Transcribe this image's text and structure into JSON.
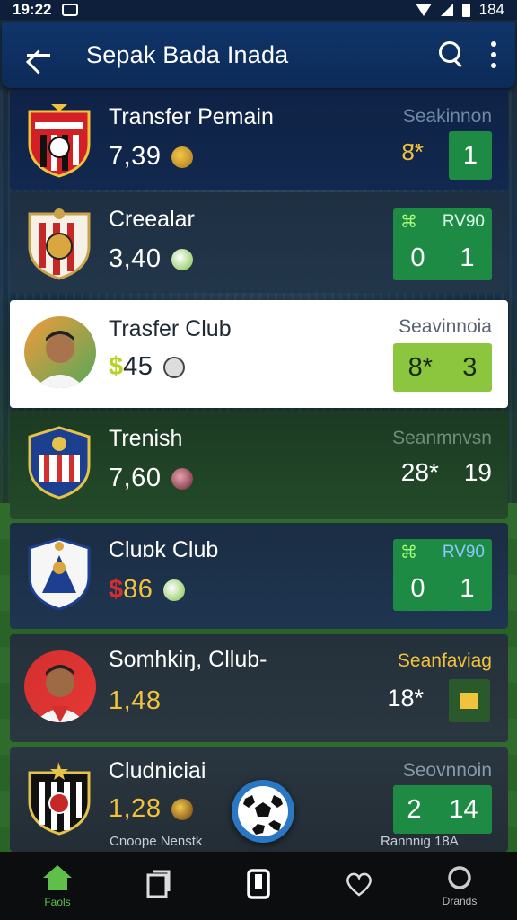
{
  "status_bar": {
    "time": "19:22",
    "battery": "184"
  },
  "app_bar": {
    "title": "Sepak Bada Inada"
  },
  "cards": [
    {
      "name": "Transfer Pemain",
      "value": "7,39",
      "currency": "",
      "right_label": "Seakinnon",
      "score": [
        "8̈*",
        "1"
      ]
    },
    {
      "name": "Creealar",
      "value": "3,40",
      "currency": "",
      "right_label": "",
      "score_header": [
        "RV90"
      ],
      "score": [
        "0",
        "1"
      ]
    },
    {
      "name": "Trasfer Club",
      "value": "45",
      "currency": "$",
      "right_label": "Seavinnoia",
      "score": [
        "8*",
        "3"
      ]
    },
    {
      "name": "Trenish",
      "value": "7,60",
      "currency": "",
      "right_label": "Seanmnvsn",
      "score": [
        "28*",
        "19"
      ]
    },
    {
      "name": "Cluɒk Club",
      "value": "86",
      "currency": "$",
      "right_label": "",
      "score_header": [
        "RV90"
      ],
      "score": [
        "0",
        "1"
      ]
    },
    {
      "name": "Somhkiŋ, Cllub-",
      "value": "1,48",
      "currency": "",
      "right_label": "Seanfaviag",
      "score": [
        "18*",
        ""
      ]
    },
    {
      "name": "Cludniciai",
      "value": "1,28",
      "currency": "",
      "right_label": "Seovnnoin",
      "score": [
        "2",
        "14"
      ]
    }
  ],
  "footer": {
    "left": "Cnoope Nenstk",
    "right": "Rannnig 18A"
  },
  "bottom_nav": [
    {
      "label": "Faols",
      "icon": "home-icon",
      "active": true
    },
    {
      "label": "",
      "icon": "card-icon",
      "active": false
    },
    {
      "label": "",
      "icon": "phone-icon",
      "active": false
    },
    {
      "label": "",
      "icon": "heart-icon",
      "active": false
    },
    {
      "label": "Drands",
      "icon": "circle-icon",
      "active": false
    }
  ],
  "colors": {
    "app_bar": "#10346a",
    "score_green": "#1e8b45",
    "lime": "#8cc63e",
    "nav_active": "#5ec04a"
  }
}
